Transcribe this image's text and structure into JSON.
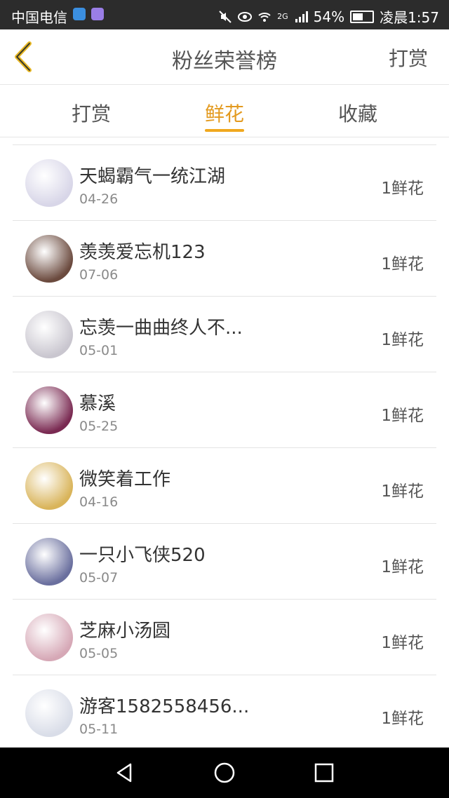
{
  "status_bar": {
    "carrier": "中国电信",
    "battery": "54%",
    "time": "凌晨1:57",
    "network": "2G",
    "icons": [
      "shield-app-icon",
      "qq-app-icon",
      "mute-icon",
      "eye-icon",
      "wifi-icon",
      "signal-icon",
      "battery-icon"
    ]
  },
  "header": {
    "back_icon": "chevron-left-icon",
    "title": "粉丝荣誉榜",
    "action": "打赏"
  },
  "tabs": [
    {
      "label": "打赏",
      "active": false
    },
    {
      "label": "鲜花",
      "active": true
    },
    {
      "label": "收藏",
      "active": false
    }
  ],
  "colors": {
    "accent": "#f0a81e",
    "text": "#333333",
    "subtext": "#8a8a8a"
  },
  "items": [
    {
      "name": "天蝎霸气一统江湖",
      "date": "04-26",
      "gift": "1鲜花",
      "avatar_color": "#d8d6e8"
    },
    {
      "name": "羡羡爱忘机123",
      "date": "07-06",
      "gift": "1鲜花",
      "avatar_color": "#6b4a3e"
    },
    {
      "name": "忘羡一曲曲终人不...",
      "date": "05-01",
      "gift": "1鲜花",
      "avatar_color": "#c9c6cf"
    },
    {
      "name": "慕溪",
      "date": "05-25",
      "gift": "1鲜花",
      "avatar_color": "#7a2a52"
    },
    {
      "name": "微笑着工作",
      "date": "04-16",
      "gift": "1鲜花",
      "avatar_color": "#d9b45a"
    },
    {
      "name": "一只小飞侠520",
      "date": "05-07",
      "gift": "1鲜花",
      "avatar_color": "#6a6f9e"
    },
    {
      "name": "芝麻小汤圆",
      "date": "05-05",
      "gift": "1鲜花",
      "avatar_color": "#d6a8b6"
    },
    {
      "name": "游客1582558456...",
      "date": "05-11",
      "gift": "1鲜花",
      "avatar_color": "#d9dde8"
    }
  ],
  "nav_bar": {
    "icons": [
      "nav-back-icon",
      "nav-home-icon",
      "nav-recent-icon"
    ]
  }
}
